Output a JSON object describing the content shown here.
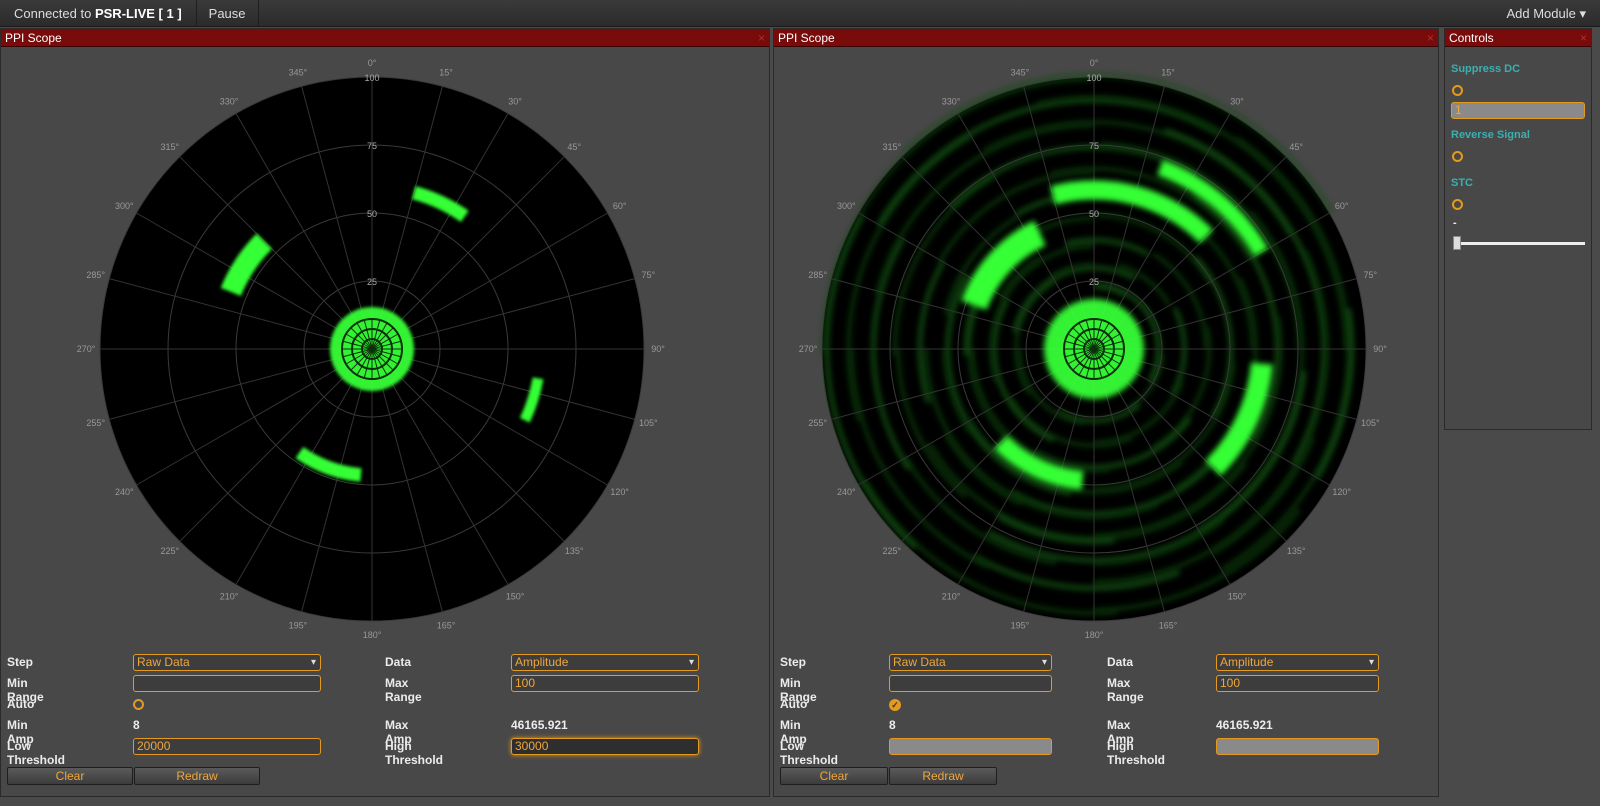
{
  "topbar": {
    "connected_prefix": "Connected to",
    "connection_name": "PSR-LIVE [ 1 ]",
    "pause_label": "Pause",
    "add_module_label": "Add Module ▾"
  },
  "scope_left": {
    "title": "PPI Scope",
    "close": "×",
    "range_labels": [
      "100",
      "75",
      "50",
      "25"
    ],
    "angle_labels": [
      "0°",
      "15°",
      "30°",
      "45°",
      "60°",
      "75°",
      "90°",
      "105°",
      "120°",
      "135°",
      "150°",
      "165°",
      "180°",
      "195°",
      "210°",
      "225°",
      "240°",
      "255°",
      "270°",
      "285°",
      "300°",
      "315°",
      "330°",
      "345°"
    ],
    "form": {
      "step_label": "Step",
      "step_value": "Raw Data",
      "data_label": "Data",
      "data_value": "Amplitude",
      "min_range_label": "Min Range",
      "min_range_value": "",
      "max_range_label": "Max Range",
      "max_range_value": "100",
      "auto_label": "Auto",
      "min_amp_label": "Min Amp",
      "min_amp_value": "8",
      "max_amp_label": "Max Amp",
      "max_amp_value": "46165.921",
      "low_threshold_label": "Low Threshold",
      "low_threshold_value": "20000",
      "high_threshold_label": "High Threshold",
      "high_threshold_value": "30000",
      "clear_label": "Clear",
      "redraw_label": "Redraw"
    }
  },
  "scope_right": {
    "title": "PPI Scope",
    "close": "×",
    "form": {
      "step_label": "Step",
      "step_value": "Raw Data",
      "data_label": "Data",
      "data_value": "Amplitude",
      "min_range_label": "Min Range",
      "min_range_value": "",
      "max_range_label": "Max Range",
      "max_range_value": "100",
      "auto_label": "Auto",
      "auto_checked": true,
      "min_amp_label": "Min Amp",
      "min_amp_value": "8",
      "max_amp_label": "Max Amp",
      "max_amp_value": "46165.921",
      "low_threshold_label": "Low Threshold",
      "low_threshold_value": "",
      "high_threshold_label": "High Threshold",
      "high_threshold_value": "",
      "clear_label": "Clear",
      "redraw_label": "Redraw"
    }
  },
  "controls": {
    "title": "Controls",
    "close": "×",
    "suppress_dc_label": "Suppress DC",
    "suppress_dc_value": "1",
    "reverse_signal_label": "Reverse Signal",
    "stc_label": "STC",
    "stc_dash": "-"
  },
  "colors": {
    "accent": "#e39a1e",
    "header": "#7a0b0b",
    "echo": "#35ff35",
    "teal": "#3ab0b0"
  }
}
